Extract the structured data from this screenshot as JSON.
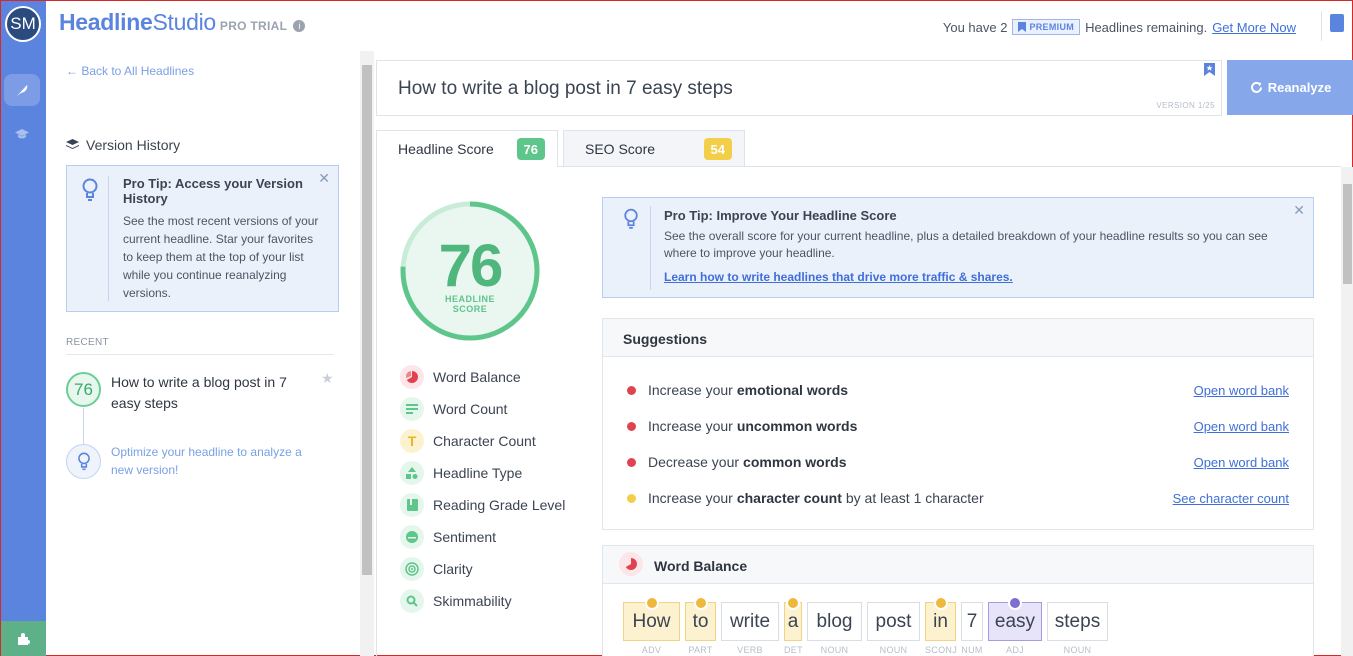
{
  "app": {
    "avatar_initials": "SM",
    "logo_bold": "Headline",
    "logo_rest": "Studio",
    "trial_label": "PRO TRIAL"
  },
  "header": {
    "remaining_prefix": "You have 2",
    "premium_badge": "PREMIUM",
    "remaining_suffix": "Headlines remaining.",
    "get_more_link": "Get More Now"
  },
  "sidebar": {
    "back_link": "← Back to All Headlines",
    "version_history_title": "Version History",
    "pro_tip": {
      "title": "Pro Tip: Access your Version History",
      "body": "See the most recent versions of your current headline. Star your favorites to keep them at the top of your list while you continue reanalyzing versions."
    },
    "recent_label": "RECENT",
    "history_item": {
      "score": "76",
      "title": "How to write a blog post in 7 easy steps"
    },
    "optimize_hint": "Optimize your headline to analyze a new version!"
  },
  "editor": {
    "headline": "How to write a blog post in 7 easy steps",
    "version": "VERSION 1/25",
    "reanalyze_label": "Reanalyze"
  },
  "tabs": [
    {
      "label": "Headline Score",
      "score": "76"
    },
    {
      "label": "SEO Score",
      "score": "54"
    }
  ],
  "score": {
    "value": "76",
    "fraction": 0.76,
    "label_line1": "HEADLINE",
    "label_line2": "SCORE"
  },
  "metrics": [
    {
      "label": "Word Balance",
      "icon": "pie-chart-icon",
      "color": "#e0434f",
      "bg": "#fde6e7"
    },
    {
      "label": "Word Count",
      "icon": "lines-icon",
      "color": "#5ec58b",
      "bg": "#e5f6ec"
    },
    {
      "label": "Character Count",
      "icon": "letter-t-icon",
      "color": "#e9b627",
      "bg": "#fdf2cf"
    },
    {
      "label": "Headline Type",
      "icon": "shapes-icon",
      "color": "#5ec58b",
      "bg": "#e5f6ec"
    },
    {
      "label": "Reading Grade Level",
      "icon": "book-icon",
      "color": "#5ec58b",
      "bg": "#e5f6ec"
    },
    {
      "label": "Sentiment",
      "icon": "face-icon",
      "color": "#5ec58b",
      "bg": "#e5f6ec"
    },
    {
      "label": "Clarity",
      "icon": "target-icon",
      "color": "#5ec58b",
      "bg": "#e5f6ec"
    },
    {
      "label": "Skimmability",
      "icon": "magnifier-icon",
      "color": "#5ec58b",
      "bg": "#e5f6ec"
    }
  ],
  "pro_tip_main": {
    "title": "Pro Tip: Improve Your Headline Score",
    "body": "See the overall score for your current headline, plus a detailed breakdown of your headline results so you can see where to improve your headline.",
    "link": "Learn how to write headlines that drive more traffic & shares."
  },
  "suggestions": {
    "title": "Suggestions",
    "items": [
      {
        "pre": "Increase your",
        "bold": "emotional words",
        "post": "",
        "action": "Open word bank",
        "severity": "red"
      },
      {
        "pre": "Increase your",
        "bold": "uncommon words",
        "post": "",
        "action": "Open word bank",
        "severity": "red"
      },
      {
        "pre": "Decrease your",
        "bold": "common words",
        "post": "",
        "action": "Open word bank",
        "severity": "red"
      },
      {
        "pre": "Increase your",
        "bold": "character count",
        "post": "by at least 1 character",
        "action": "See character count",
        "severity": "yellow"
      }
    ]
  },
  "word_balance": {
    "title": "Word Balance",
    "words": [
      {
        "text": "How",
        "pos": "ADV",
        "type": "y"
      },
      {
        "text": "to",
        "pos": "PART",
        "type": "y"
      },
      {
        "text": "write",
        "pos": "VERB",
        "type": "n"
      },
      {
        "text": "a",
        "pos": "DET",
        "type": "y"
      },
      {
        "text": "blog",
        "pos": "NOUN",
        "type": "n"
      },
      {
        "text": "post",
        "pos": "NOUN",
        "type": "n"
      },
      {
        "text": "in",
        "pos": "SCONJ",
        "type": "y"
      },
      {
        "text": "7",
        "pos": "NUM",
        "type": "n"
      },
      {
        "text": "easy",
        "pos": "ADJ",
        "type": "p"
      },
      {
        "text": "steps",
        "pos": "NOUN",
        "type": "n"
      }
    ]
  }
}
